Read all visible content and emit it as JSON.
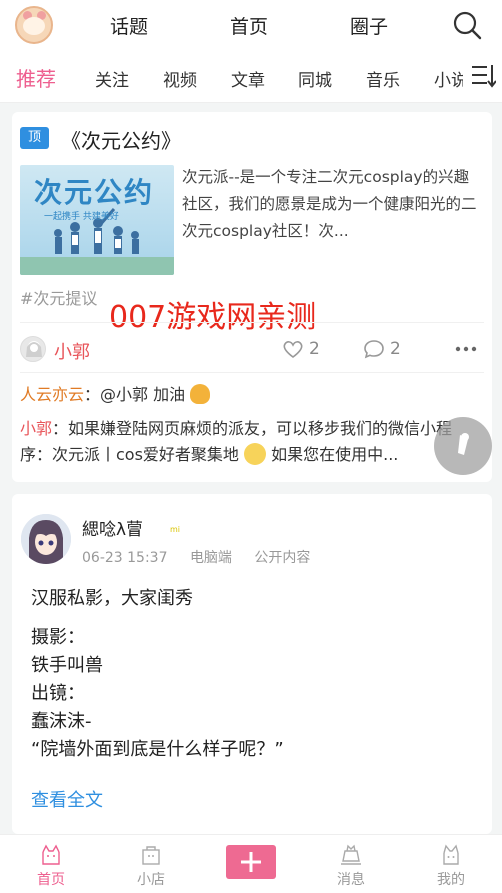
{
  "top_nav": {
    "items": [
      "话题",
      "首页",
      "圈子"
    ]
  },
  "category_tabs": [
    "推荐",
    "关注",
    "视频",
    "文章",
    "同城",
    "音乐",
    "小说"
  ],
  "pinned_post": {
    "badge": "顶",
    "title": "《次元公约》",
    "thumbnail_title": "次元公约",
    "thumbnail_slogan": "一起携手 共建美好",
    "excerpt": "次元派--是一个专注二次元cosplay的兴趣社区，我们的愿景是成为一个健康阳光的二次元cosplay社区！次...",
    "tag": "#次元提议",
    "watermark": "007游戏网亲测",
    "author": "小郭",
    "likes": "2",
    "comments": "2",
    "comment_list": [
      {
        "name": "人云亦云",
        "text": "：@小郭 加油"
      },
      {
        "name": "小郭",
        "text": "：如果嫌登陆网页麻烦的派友，可以移步我们的微信小程序：次元派丨cos爱好者聚集地",
        "text_tail": " 如果您在使用中..."
      }
    ]
  },
  "user_post": {
    "username": "緦唸λ萺",
    "badge": "mi",
    "date": "06-23 15:37",
    "device": "电脑端",
    "visibility": "公开内容",
    "lines": [
      "汉服私影，大家闺秀",
      "摄影：",
      "铁手叫兽",
      "出镜：",
      "蠢沫沫-",
      "“院墙外面到底是什么样子呢？”"
    ],
    "read_more": "查看全文"
  },
  "bottom_tabs": [
    {
      "label": "首页",
      "icon": "home-icon"
    },
    {
      "label": "小店",
      "icon": "shop-icon"
    },
    {
      "label": "消息",
      "icon": "message-icon"
    },
    {
      "label": "我的",
      "icon": "profile-icon"
    }
  ],
  "colors": {
    "accent": "#ee5f8f",
    "link": "#2f8fe0",
    "watermark": "#e8281c",
    "author": "#e8555a",
    "commenter": "#e07b25"
  }
}
